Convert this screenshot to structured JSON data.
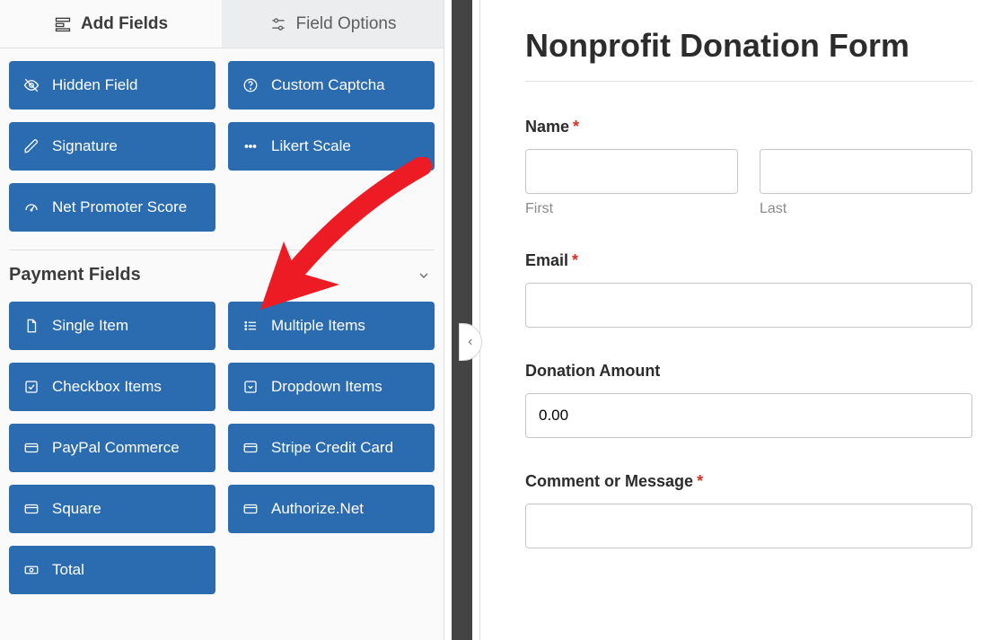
{
  "tabs": {
    "add_fields": "Add Fields",
    "field_options": "Field Options"
  },
  "misc_fields": [
    {
      "label": "Hidden Field",
      "icon": "hidden"
    },
    {
      "label": "Custom Captcha",
      "icon": "question"
    },
    {
      "label": "Signature",
      "icon": "pencil"
    },
    {
      "label": "Likert Scale",
      "icon": "dots"
    },
    {
      "label": "Net Promoter Score",
      "icon": "gauge"
    }
  ],
  "payment_section": {
    "title": "Payment Fields"
  },
  "payment_fields": [
    {
      "label": "Single Item",
      "icon": "file"
    },
    {
      "label": "Multiple Items",
      "icon": "list"
    },
    {
      "label": "Checkbox Items",
      "icon": "checkbox"
    },
    {
      "label": "Dropdown Items",
      "icon": "caret-square"
    },
    {
      "label": "PayPal Commerce",
      "icon": "card"
    },
    {
      "label": "Stripe Credit Card",
      "icon": "card"
    },
    {
      "label": "Square",
      "icon": "card"
    },
    {
      "label": "Authorize.Net",
      "icon": "card"
    },
    {
      "label": "Total",
      "icon": "money"
    }
  ],
  "form": {
    "title": "Nonprofit Donation Form",
    "name_label": "Name",
    "first_sublabel": "First",
    "last_sublabel": "Last",
    "email_label": "Email",
    "donation_label": "Donation Amount",
    "donation_value": "0.00",
    "comment_label": "Comment or Message"
  }
}
